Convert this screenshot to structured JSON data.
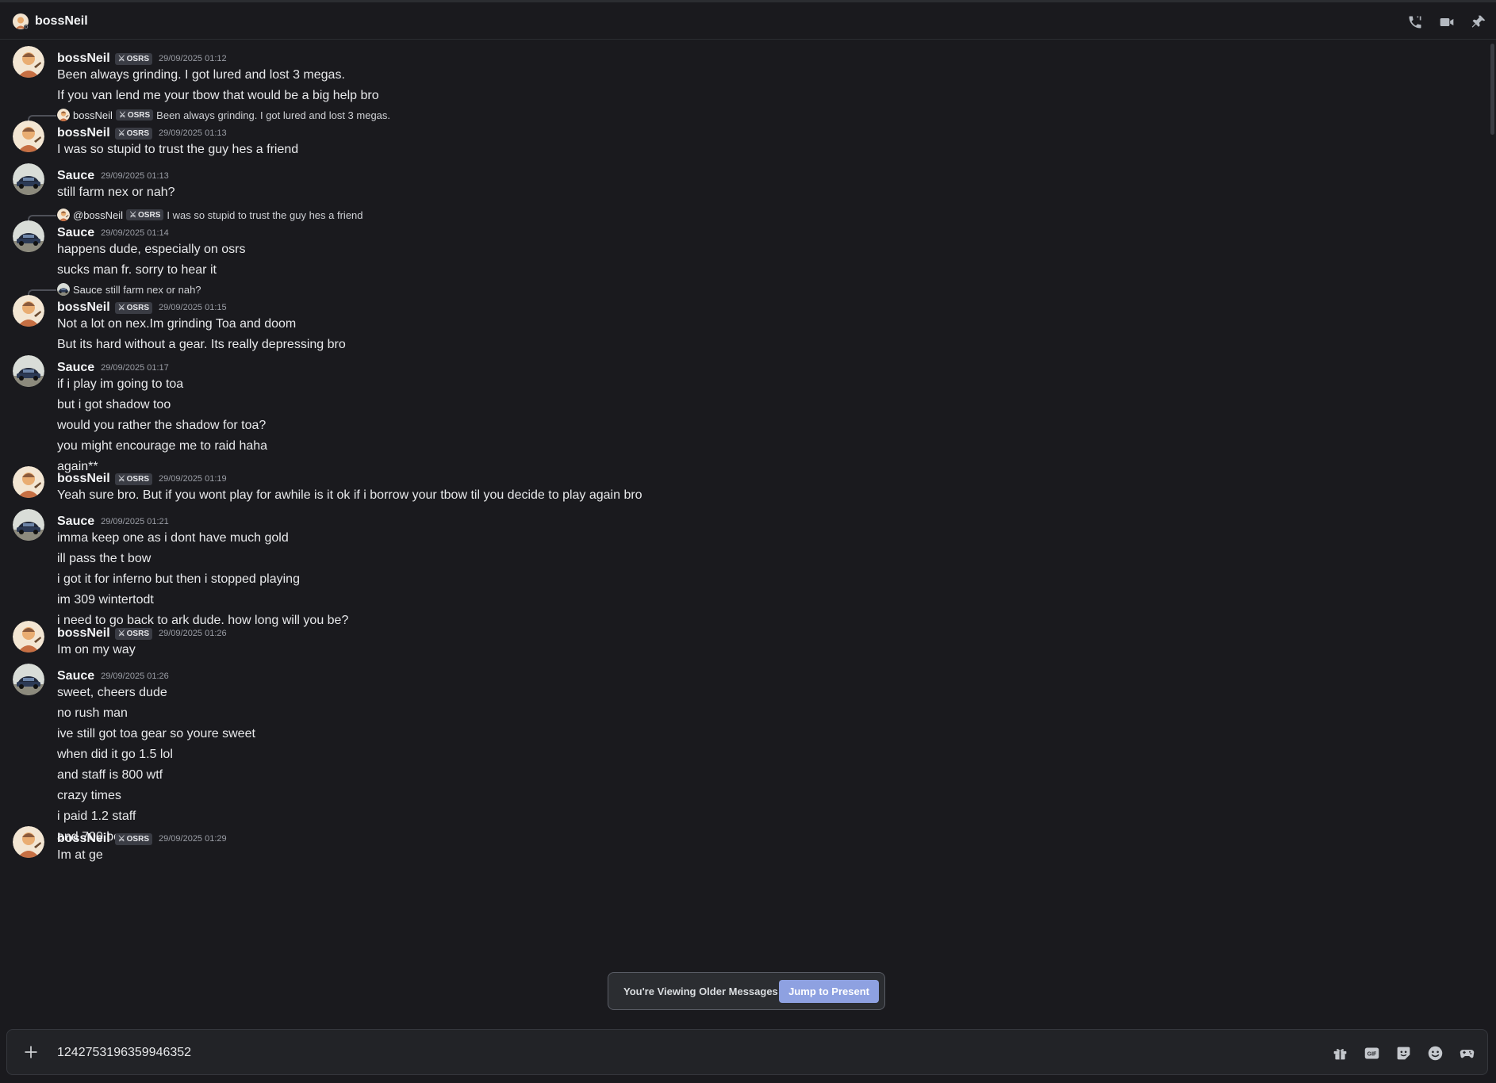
{
  "header": {
    "title": "bossNeil",
    "icons": [
      "phone-call-icon",
      "video-call-icon",
      "pin-icon"
    ]
  },
  "tag_label": "OSRS",
  "tag_icon": "crossed-swords-icon",
  "messages": [
    {
      "type": "msg",
      "user": "bossNeil",
      "avatar": "neil",
      "tag": true,
      "ts": "29/09/2025 01:12",
      "lines": [
        "Been always grinding. I got lured and lost 3 megas.",
        "If you van lend me your tbow that would be a big help bro"
      ]
    },
    {
      "type": "msg",
      "user": "bossNeil",
      "avatar": "neil",
      "tag": true,
      "ts": "29/09/2025 01:13",
      "reply": {
        "avatar": "neil",
        "name": "bossNeil",
        "tag": true,
        "text": "Been always grinding. I got lured and lost 3 megas."
      },
      "lines": [
        "I was so stupid to trust the guy hes a friend"
      ]
    },
    {
      "type": "msg",
      "user": "Sauce",
      "avatar": "sauce",
      "tag": false,
      "ts": "29/09/2025 01:13",
      "lines": [
        "still farm nex or nah?"
      ]
    },
    {
      "type": "msg",
      "user": "Sauce",
      "avatar": "sauce",
      "tag": false,
      "ts": "29/09/2025 01:14",
      "reply": {
        "avatar": "neil",
        "name": "@bossNeil",
        "tag": true,
        "text": "I was so stupid to trust the guy hes a friend"
      },
      "lines": [
        "happens dude, especially on osrs",
        "sucks man fr. sorry to hear it"
      ]
    },
    {
      "type": "msg",
      "user": "bossNeil",
      "avatar": "neil",
      "tag": true,
      "ts": "29/09/2025 01:15",
      "reply": {
        "avatar": "sauce",
        "name": "Sauce",
        "tag": false,
        "text": "still farm nex or nah?"
      },
      "lines": [
        "Not a lot on nex.Im grinding Toa and doom",
        "But its hard without a gear. Its really depressing bro"
      ]
    },
    {
      "type": "msg",
      "user": "Sauce",
      "avatar": "sauce",
      "tag": false,
      "ts": "29/09/2025 01:17",
      "lines": [
        "if i play im going to toa",
        "but i got shadow too",
        "would you rather the shadow for toa?",
        "you might encourage me to raid haha",
        "again**"
      ]
    },
    {
      "type": "msg",
      "user": "bossNeil",
      "avatar": "neil",
      "tag": true,
      "ts": "29/09/2025 01:19",
      "lines": [
        "Yeah sure bro. But if you wont play for awhile is it ok if i borrow your tbow til you decide to play again bro"
      ]
    },
    {
      "type": "msg",
      "user": "Sauce",
      "avatar": "sauce",
      "tag": false,
      "ts": "29/09/2025 01:21",
      "lines": [
        "imma keep one as i dont have much gold",
        "ill pass the t bow",
        "i got it for inferno but then i stopped playing",
        "im 309 wintertodt",
        "i need to go back to ark dude. how long will you be?"
      ]
    },
    {
      "type": "msg",
      "user": "bossNeil",
      "avatar": "neil",
      "tag": true,
      "ts": "29/09/2025 01:26",
      "lines": [
        "Im on my way"
      ]
    },
    {
      "type": "msg",
      "user": "Sauce",
      "avatar": "sauce",
      "tag": false,
      "ts": "29/09/2025 01:26",
      "lines": [
        "sweet, cheers dude",
        "no rush man",
        "ive still got toa gear so youre sweet",
        "when did it go 1.5 lol",
        "and staff is 800 wtf",
        "crazy times",
        "i paid 1.2 staff",
        "and 700 bow"
      ]
    },
    {
      "type": "msg",
      "user": "bossNeil",
      "avatar": "neil",
      "tag": true,
      "ts": "29/09/2025 01:29",
      "lines": [
        "Im at ge"
      ]
    }
  ],
  "banner": {
    "text": "You're Viewing Older Messages",
    "button": "Jump to Present"
  },
  "composer": {
    "value": "1242753196359946352",
    "icons": [
      "add-icon",
      "gift-icon",
      "gif-icon",
      "sticker-icon",
      "emoji-icon",
      "game-controller-icon"
    ]
  }
}
